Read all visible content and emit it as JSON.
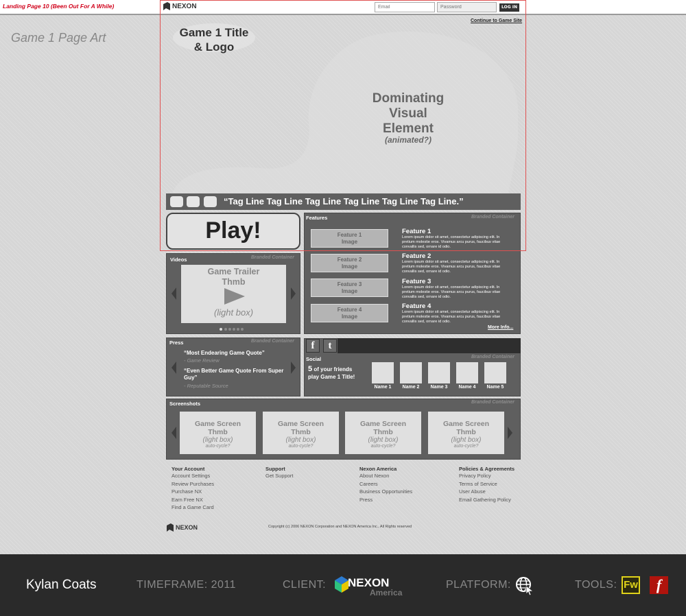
{
  "page_label": "Landing Page 10 (Been Out For A While)",
  "header": {
    "brand": "NEXON",
    "email_placeholder": "Email",
    "password_placeholder": "Password",
    "login_label": "LOG IN",
    "continue_link": "Continue to Game Site"
  },
  "page_art_label": "Game 1 Page Art",
  "hero": {
    "title_lines": [
      "Game 1 Title",
      "& Logo"
    ],
    "visual_lines": [
      "Dominating",
      "Visual",
      "Element"
    ],
    "visual_note": "(animated?)"
  },
  "tagline": "“Tag Line Tag Line Tag Line Tag Line Tag Line Tag Line.”",
  "play_label": "Play!",
  "branded_label": "Branded Container",
  "features": {
    "title": "Features",
    "items": [
      {
        "image": [
          "Feature 1",
          "Image"
        ],
        "title": "Feature 1",
        "text": "Lorem ipsum dolor sit amet, consectetur adipiscing elit. In pretium molestie eros. Vivamus arcu purus, faucibus vitae convallis sed, ornare id odio."
      },
      {
        "image": [
          "Feature 2",
          "Image"
        ],
        "title": "Feature 2",
        "text": "Lorem ipsum dolor sit amet, consectetur adipiscing elit. In pretium molestie eros. Vivamus arcu purus, faucibus vitae convallis sed, ornare id odio."
      },
      {
        "image": [
          "Feature 3",
          "Image"
        ],
        "title": "Feature 3",
        "text": "Lorem ipsum dolor sit amet, consectetur adipiscing elit. In pretium molestie eros. Vivamus arcu purus, faucibus vitae convallis sed, ornare id odio."
      },
      {
        "image": [
          "Feature 4",
          "Image"
        ],
        "title": "Feature 4",
        "text": "Lorem ipsum dolor sit amet, consectetur adipiscing elit. In pretium molestie eros. Vivamus arcu purus, faucibus vitae convallis sed, ornare id odio."
      }
    ],
    "more_info": "More Info..."
  },
  "videos": {
    "title": "Videos",
    "thumb_title": [
      "Game Trailer",
      "Thmb"
    ],
    "thumb_note": "(light box)",
    "carousel_dots": 6,
    "active_dot": 1
  },
  "press": {
    "title": "Press",
    "quotes": [
      {
        "quote": "“Most Endearing Game Quote”",
        "source": "- Game Review"
      },
      {
        "quote": "“Even Better Game Quote From Super Guy”",
        "source": "- Reputable Source"
      }
    ]
  },
  "social": {
    "title": "Social",
    "facebook_glyph": "f",
    "twitter_glyph": "t",
    "friends_count": "5",
    "friends_text_1": " of your friends",
    "friends_text_2": "play Game 1 Title!",
    "friends": [
      "Name 1",
      "Name 2",
      "Name 3",
      "Name 4",
      "Name 5"
    ]
  },
  "screenshots": {
    "title": "Screenshots",
    "items": [
      {
        "title": [
          "Game Screen",
          "Thmb"
        ],
        "note": "(light box)",
        "sub": "auto-cycle?"
      },
      {
        "title": [
          "Game Screen",
          "Thmb"
        ],
        "note": "(light box)",
        "sub": "auto-cycle?"
      },
      {
        "title": [
          "Game Screen",
          "Thmb"
        ],
        "note": "(light box)",
        "sub": "auto-cycle?"
      },
      {
        "title": [
          "Game Screen",
          "Thmb"
        ],
        "note": "(light box)",
        "sub": "auto-cycle?"
      }
    ]
  },
  "footer": {
    "columns": [
      {
        "heading": "Your Account",
        "links": [
          "Account Settings",
          "Review Purchases",
          "Purchase NX",
          "Earn Free NX",
          "Find a Game Card"
        ]
      },
      {
        "heading": "Support",
        "links": [
          "Get Support"
        ]
      },
      {
        "heading": "Nexon America",
        "links": [
          "About Nexon",
          "Careers",
          "Business Opportunities",
          "Press"
        ]
      },
      {
        "heading": "Policies & Agreements",
        "links": [
          "Privacy Policy",
          "Terms of Service",
          "User Abuse",
          "Email Gathering Policy"
        ]
      }
    ],
    "brand": "NEXON",
    "copyright": "Copyright (c) 2006 NEXON Corporation and NEXON America Inc., All Rights reserved"
  },
  "credits": {
    "author": "Kylan Coats",
    "timeframe": "TIMEFRAME: 2011",
    "client_label": "CLIENT:",
    "client_name": "NEXON",
    "client_sub": "America",
    "platform_label": "PLATFORM:",
    "platform_icon": "globe-cursor-icon",
    "tools_label": "TOOLS:",
    "tool_fw": "Fw",
    "tool_flash": "f"
  },
  "colors": {
    "accent_red": "#d0021b",
    "panel": "#5f5f5f",
    "background": "#d6d6d6",
    "bottom_bar": "#2a2a2a",
    "fw_yellow": "#e0d31a",
    "flash_red": "#b0140d"
  }
}
